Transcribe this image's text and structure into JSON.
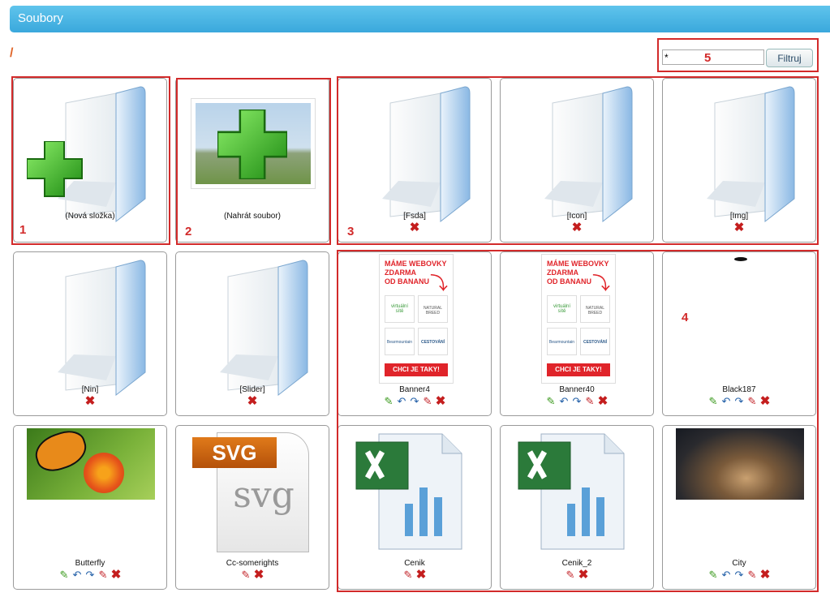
{
  "header": {
    "title": "Soubory"
  },
  "path": "/",
  "filter": {
    "value": "*",
    "button_label": "Filtruj"
  },
  "annotations": [
    "1",
    "2",
    "3",
    "4",
    "5"
  ],
  "cards": {
    "new_folder": "(Nová složka)",
    "upload": "(Nahrát soubor)",
    "fsda": "[Fsda]",
    "icon": "[Icon]",
    "img": "[Img]",
    "nin": "[Nin]",
    "slider": "[Slider]",
    "banner4": "Banner4",
    "banner40": "Banner40",
    "black187": "Black187",
    "butterfly": "Butterfly",
    "cc_somerights": "Cc-somerights",
    "cenik": "Cenik",
    "cenik2": "Cenik_2",
    "city": "City"
  },
  "banner": {
    "headline1": "MÁME WEBOVKY",
    "headline2": "ZDARMA",
    "headline3": "OD BANANU",
    "logo1a": "virtuální",
    "logo1b": "sítě",
    "logo2a": "NATURAL",
    "logo2b": "BREED",
    "logo3a": "Bearmountain",
    "logo4a": "CESTOVÁNÍ",
    "cta": "CHCI JE TAKY!"
  },
  "svg_badge": "SVG",
  "svg_text": "svg",
  "icons": {
    "edit": "✎",
    "move_left": "↶",
    "move_right": "↷",
    "delete": "✖"
  },
  "colors": {
    "header": "#3aa8dc",
    "annotation": "#d22a2a",
    "path": "#e0662a"
  }
}
